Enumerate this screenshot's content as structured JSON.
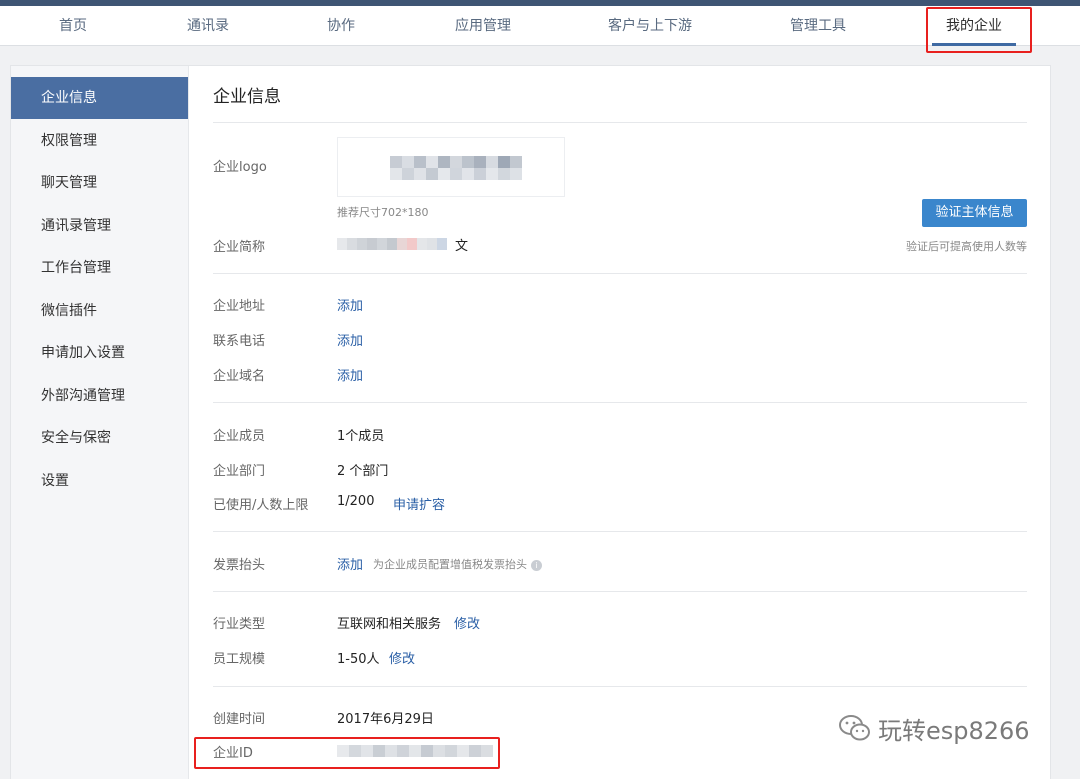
{
  "nav": {
    "items": [
      {
        "label": "首页"
      },
      {
        "label": "通讯录"
      },
      {
        "label": "协作"
      },
      {
        "label": "应用管理"
      },
      {
        "label": "客户与上下游"
      },
      {
        "label": "管理工具"
      },
      {
        "label": "我的企业"
      }
    ],
    "active_index": 6
  },
  "sidebar": {
    "items": [
      {
        "label": "企业信息"
      },
      {
        "label": "权限管理"
      },
      {
        "label": "聊天管理"
      },
      {
        "label": "通讯录管理"
      },
      {
        "label": "工作台管理"
      },
      {
        "label": "微信插件"
      },
      {
        "label": "申请加入设置"
      },
      {
        "label": "外部沟通管理"
      },
      {
        "label": "安全与保密"
      },
      {
        "label": "设置"
      }
    ],
    "active_index": 0
  },
  "page": {
    "title": "企业信息",
    "logo_label": "企业logo",
    "logo_hint": "推荐尺寸702*180",
    "short_name_label": "企业简称",
    "short_name_tail": "文",
    "verify_button": "验证主体信息",
    "verify_hint": "验证后可提高使用人数等",
    "address_label": "企业地址",
    "address_action": "添加",
    "phone_label": "联系电话",
    "phone_action": "添加",
    "domain_label": "企业域名",
    "domain_action": "添加",
    "members_label": "企业成员",
    "members_value": "1个成员",
    "departments_label": "企业部门",
    "departments_value": "2 个部门",
    "quota_label": "已使用/人数上限",
    "quota_value": "1/200",
    "quota_action": "申请扩容",
    "invoice_label": "发票抬头",
    "invoice_action": "添加",
    "invoice_hint": "为企业成员配置增值税发票抬头",
    "info_glyph": "i",
    "industry_label": "行业类型",
    "industry_value": "互联网和相关服务",
    "industry_action": "修改",
    "scale_label": "员工规模",
    "scale_value": "1-50人",
    "scale_action": "修改",
    "created_label": "创建时间",
    "created_value": "2017年6月29日",
    "id_label": "企业ID"
  },
  "watermark": {
    "text": "玩转esp8266"
  },
  "colors": {
    "accent": "#3f6aa3",
    "sidebar_active": "#4a6ea2",
    "link": "#2a5fa6",
    "button": "#3a86cc",
    "highlight_box": "#e8201e"
  }
}
